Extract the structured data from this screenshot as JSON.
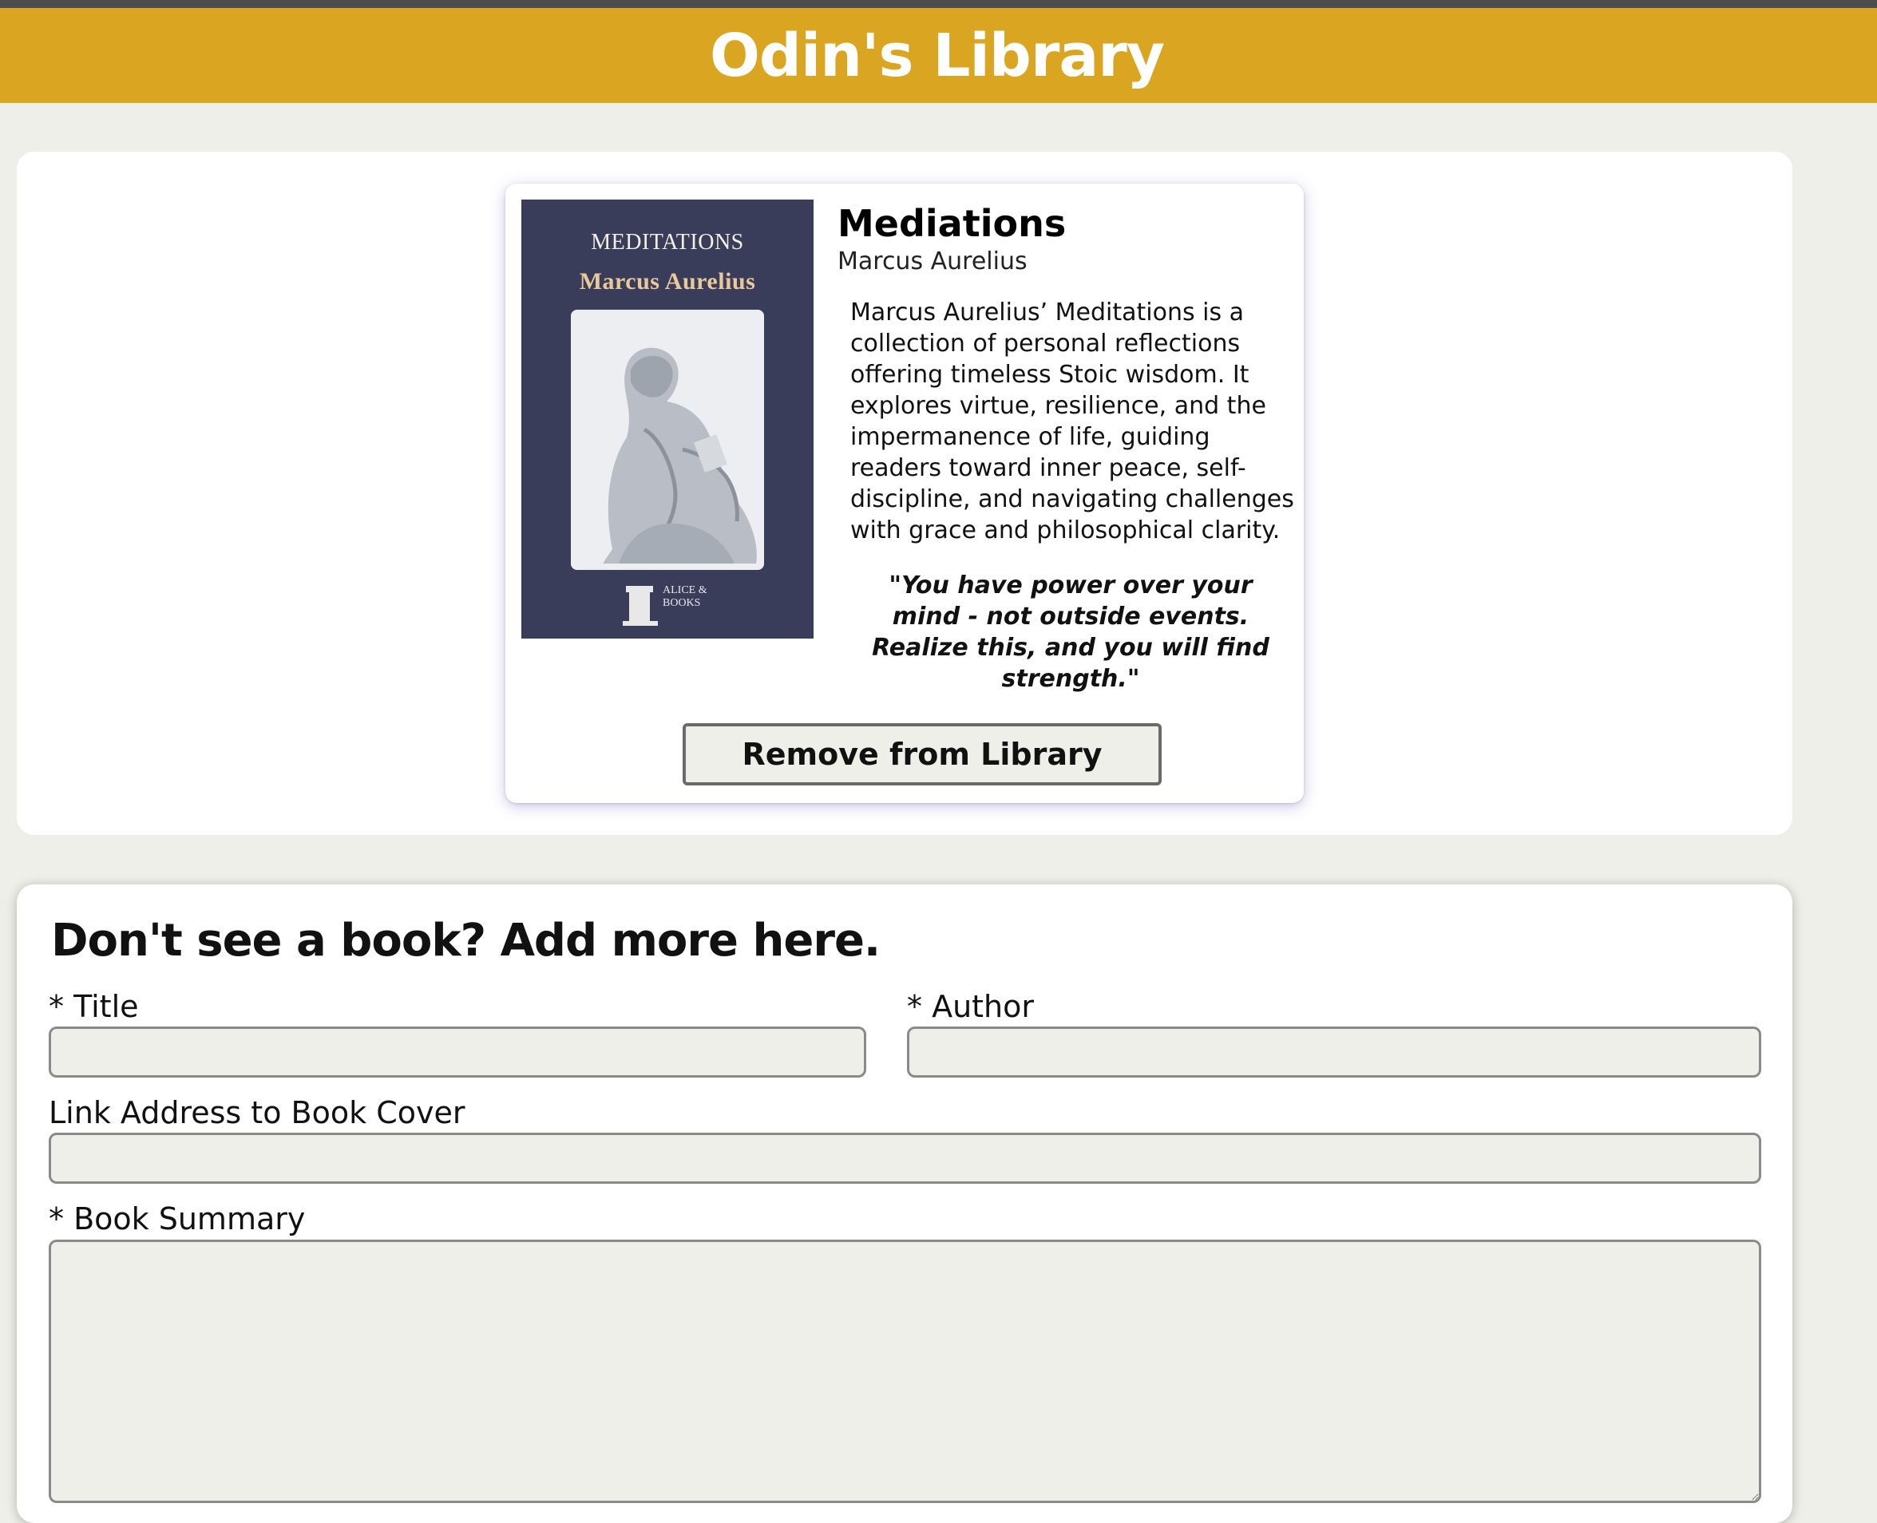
{
  "header": {
    "title": "Odin's Library"
  },
  "library": {
    "books": [
      {
        "title": "Mediations",
        "author": "Marcus Aurelius",
        "cover": {
          "title_text": "MEDITATIONS",
          "author_text": "Marcus Aurelius",
          "publisher_text": "ALICE & BOOKS"
        },
        "summary": "Marcus Aurelius’ Meditations is a collection of personal reflections offering timeless Stoic wisdom. It explores virtue, resilience, and the impermanence of life, guiding readers toward inner peace, self-discipline, and navigating challenges with grace and philosophical clarity.",
        "quote": "\"You have power over your mind - not outside events. Realize this, and you will find strength.\"",
        "remove_label": "Remove from Library"
      }
    ]
  },
  "form": {
    "heading": "Don't see a book? Add more here.",
    "title_label": "* Title",
    "author_label": "* Author",
    "cover_label": "Link Address to Book Cover",
    "summary_label": "* Book Summary",
    "title_value": "",
    "author_value": "",
    "cover_value": "",
    "summary_value": ""
  },
  "colors": {
    "header_bg": "#daa520",
    "page_bg": "#efefe9",
    "cover_bg": "#3a3d5a"
  }
}
